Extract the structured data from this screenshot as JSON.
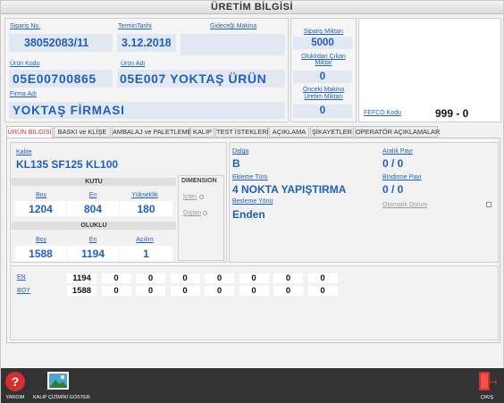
{
  "window": {
    "title": "ÜRETİM BİLGİSİ"
  },
  "order": {
    "siparis_no_label": "Sipariş No.",
    "siparis_no": "38052083/11",
    "termin_label": "TerminTarihi",
    "termin": "3.12.2018",
    "gidecegi_makina_label": "Gideceği Makina",
    "gidecegi_makina": "",
    "urun_kodu_label": "Ürün Kodu",
    "urun_kodu": "05E00700865",
    "urun_adi_label": "Ürün Adı",
    "urun_adi": "05E007 YOKTAŞ ÜRÜN",
    "firma_adi_label": "Firma Adı",
    "firma_adi": "YOKTAŞ FİRMASI"
  },
  "quantities": {
    "siparis_miktari_label": "Sipariş Miktarı",
    "siparis_miktari": "5000",
    "oluklu_cikan_label_1": "Oluklıdan Çıkan",
    "oluklu_cikan_label_2": "Miktar",
    "oluklu_cikan": "0",
    "onceki_makina_label_1": "Önceki Makina",
    "onceki_makina_label_2": "Üretim Miktarı",
    "onceki_makina": "0"
  },
  "fefco": {
    "label": "FEFCO Kodu",
    "value": "999 - 0"
  },
  "tabs": [
    {
      "label": "ÜRÜN BİLGİSİ"
    },
    {
      "label": "BASKI ve KLİŞE"
    },
    {
      "label": "AMBALAJ ve PALETLEME"
    },
    {
      "label": "KALIP"
    },
    {
      "label": "TEST İSTEKLERİ"
    },
    {
      "label": "AÇIKLAMA"
    },
    {
      "label": "ŞİKAYETLER"
    },
    {
      "label": "OPERATÖR AÇIKLAMALAR"
    }
  ],
  "product": {
    "kalite_label": "Kalite",
    "kalite": "KL135 SF125 KL100",
    "kutu": {
      "header": "KUTU",
      "boy_label": "Boy",
      "boy": "1204",
      "en_label": "En",
      "en": "804",
      "yukseklik_label": "Yükseklik",
      "yukseklik": "180"
    },
    "oluklu": {
      "header": "OLUKLU",
      "boy_label": "Boy",
      "boy": "1588",
      "en_label": "En",
      "en": "1194",
      "acilim_label": "Açılım",
      "acilim": "1"
    },
    "dimension": {
      "header": "DIMENSION",
      "icten_label": "İçten",
      "distan_label": "Dıştan"
    },
    "dalga_label": "Dalga",
    "dalga": "B",
    "ekleme_turu_label": "Ekleme Türü",
    "ekleme_turu": "4 NOKTA YAPIŞTIRMA",
    "besleme_yonu_label": "Besleme Yönü",
    "besleme_yonu": "Enden",
    "aralik_payi_label": "Aralık Payı",
    "aralik_payi": "0 / 0",
    "bindirme_payi_label": "Bindirme Payı",
    "bindirme_payi": "0 / 0",
    "otomatik_dolum_label": "Otomatik Dolum"
  },
  "dim_grid": {
    "en_label": "EN",
    "boy_label": "BOY",
    "en_values": [
      "1194",
      "0",
      "0",
      "0",
      "0",
      "0",
      "0",
      "0"
    ],
    "boy_values": [
      "1588",
      "0",
      "0",
      "0",
      "0",
      "0",
      "0",
      "0"
    ]
  },
  "bottom": {
    "help_label": "YARDIM",
    "kalip_label": "KALIP ÇİZİMİNİ GÖSTER",
    "exit_label": "ÇIKIŞ"
  }
}
